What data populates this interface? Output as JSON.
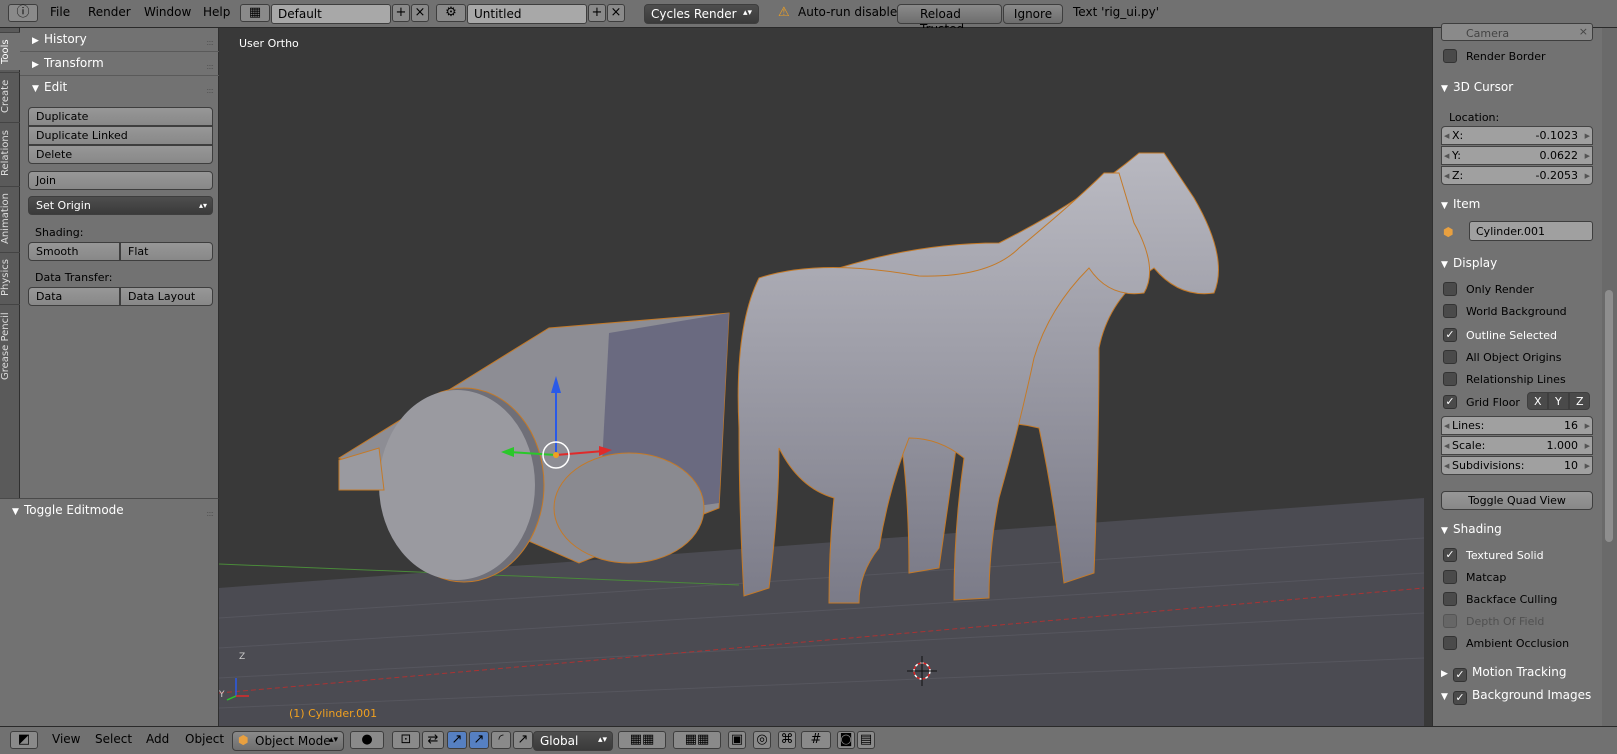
{
  "topbar": {
    "menus": [
      "File",
      "Render",
      "Window",
      "Help"
    ],
    "screen_layout": "Default",
    "scene": "Untitled",
    "render_engine": "Cycles Render",
    "autorun_warning": "Auto-run disabled",
    "reload_trusted": "Reload Trusted",
    "ignore": "Ignore",
    "text_label": "Text 'rig_ui.py'"
  },
  "tool_tabs": [
    "Tools",
    "Create",
    "Relations",
    "Animation",
    "Physics",
    "Grease Pencil"
  ],
  "tool_panel": {
    "history": "History",
    "transform": "Transform",
    "edit": "Edit",
    "duplicate": "Duplicate",
    "duplicate_linked": "Duplicate Linked",
    "delete": "Delete",
    "join": "Join",
    "set_origin": "Set Origin",
    "shading_label": "Shading:",
    "smooth": "Smooth",
    "flat": "Flat",
    "data_transfer_label": "Data Transfer:",
    "data": "Data",
    "data_layout": "Data Layout"
  },
  "operator_panel": {
    "title": "Toggle Editmode"
  },
  "viewport": {
    "view_label": "User Ortho",
    "object_label": "(1) Cylinder.001",
    "axis_z": "Z",
    "axis_y": "Y"
  },
  "properties": {
    "camera_label": "Camera",
    "render_border": "Render Border",
    "cursor_title": "3D Cursor",
    "location_label": "Location:",
    "x_label": "X:",
    "x_value": "-0.1023",
    "y_label": "Y:",
    "y_value": "0.0622",
    "z_label": "Z:",
    "z_value": "-0.2053",
    "item_title": "Item",
    "item_name": "Cylinder.001",
    "display_title": "Display",
    "only_render": "Only Render",
    "world_background": "World Background",
    "outline_selected": "Outline Selected",
    "all_object_origins": "All Object Origins",
    "relationship_lines": "Relationship Lines",
    "grid_floor": "Grid Floor",
    "axis_x_btn": "X",
    "axis_y_btn": "Y",
    "axis_z_btn": "Z",
    "lines_label": "Lines:",
    "lines_value": "16",
    "scale_label": "Scale:",
    "scale_value": "1.000",
    "subdiv_label": "Subdivisions:",
    "subdiv_value": "10",
    "toggle_quad": "Toggle Quad View",
    "shading_title": "Shading",
    "textured_solid": "Textured Solid",
    "matcap": "Matcap",
    "backface_culling": "Backface Culling",
    "depth_of_field": "Depth Of Field",
    "ambient_occlusion": "Ambient Occlusion",
    "motion_tracking": "Motion Tracking",
    "background_images": "Background Images",
    "check_mark": "✓"
  },
  "bottombar": {
    "menus": [
      "View",
      "Select",
      "Add",
      "Object"
    ],
    "mode": "Object Mode",
    "orientation": "Global"
  }
}
